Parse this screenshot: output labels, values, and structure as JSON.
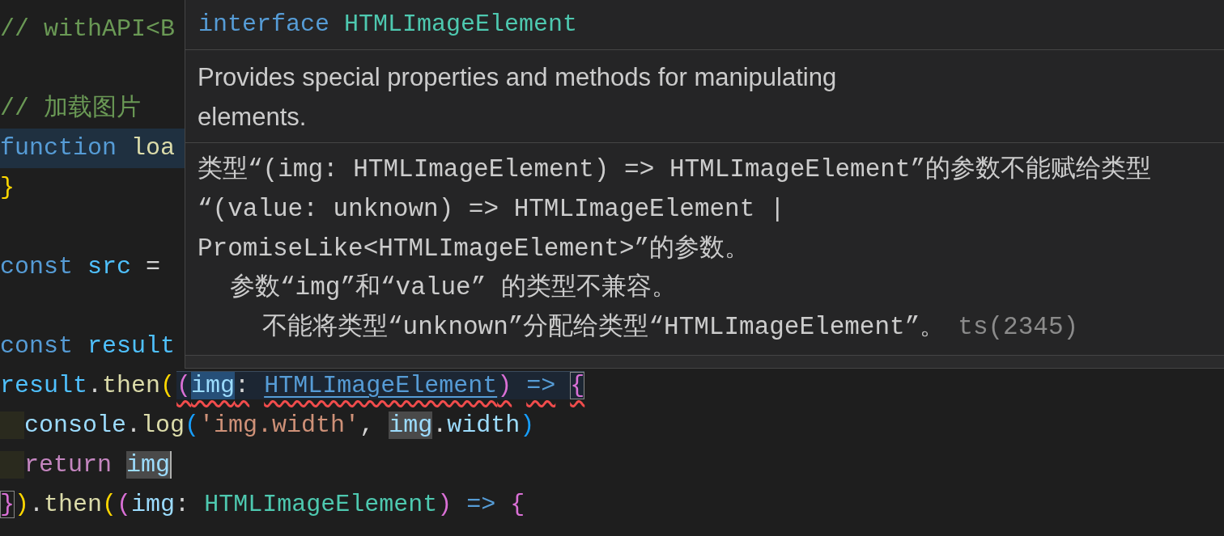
{
  "editor": {
    "lines": [
      {
        "tokens": [
          {
            "text": "// withAPI<B",
            "kind": "comment"
          }
        ]
      },
      {
        "blank_before": true,
        "tokens": [
          {
            "text": "// 加载图片",
            "kind": "comment"
          }
        ]
      },
      {
        "highlighted": true,
        "tokens": [
          {
            "text": "function",
            "kind": "keyword"
          },
          {
            "text": "loa",
            "kind": "function",
            "space": true
          }
        ]
      },
      {
        "tokens": [
          {
            "text": "}",
            "kind": "bracket_yellow"
          }
        ]
      },
      {
        "blank_before": true,
        "tokens": [
          {
            "text": "const",
            "kind": "keyword"
          },
          {
            "text": "src",
            "kind": "constant",
            "space": true
          },
          {
            "text": "=",
            "kind": "plain",
            "space": true
          }
        ]
      },
      {
        "blank_before": true,
        "tokens": [
          {
            "text": "const",
            "kind": "keyword"
          },
          {
            "text": "result",
            "kind": "constant",
            "space": true
          }
        ]
      },
      {
        "tokens": [
          {
            "text": "result",
            "kind": "constant"
          },
          {
            "text": ".",
            "kind": "plain"
          },
          {
            "text": "then",
            "kind": "function"
          },
          {
            "text": "(",
            "kind": "bracket_yellow"
          }
        ],
        "range": {
          "error": true,
          "tokens": [
            {
              "text": "(",
              "kind": "bracket_pink"
            },
            {
              "text": "img",
              "kind": "variable",
              "selected": true
            },
            {
              "text": ":",
              "kind": "plain"
            },
            {
              "text": "HTMLImageElement",
              "kind": "type_link",
              "space": true,
              "link": true
            },
            {
              "text": ")",
              "kind": "bracket_pink"
            },
            {
              "text": "=>",
              "kind": "keyword",
              "space": true
            },
            {
              "text": "{",
              "kind": "bracket_pink",
              "space": true,
              "bracket_match": true
            }
          ]
        }
      },
      {
        "indent": true,
        "tokens": [
          {
            "text": "console",
            "kind": "variable"
          },
          {
            "text": ".",
            "kind": "plain"
          },
          {
            "text": "log",
            "kind": "function"
          },
          {
            "text": "(",
            "kind": "bracket_blue"
          },
          {
            "text": "'img.width'",
            "kind": "string"
          },
          {
            "text": ",",
            "kind": "plain"
          },
          {
            "text": "img",
            "kind": "variable",
            "space": true,
            "reference": true
          },
          {
            "text": ".",
            "kind": "plain"
          },
          {
            "text": "width",
            "kind": "variable"
          },
          {
            "text": ")",
            "kind": "bracket_blue"
          }
        ]
      },
      {
        "indent": true,
        "cursor": true,
        "tokens": [
          {
            "text": "return",
            "kind": "control"
          },
          {
            "text": "img",
            "kind": "variable",
            "space": true,
            "reference": true
          }
        ]
      },
      {
        "tokens": [
          {
            "text": "}",
            "kind": "bracket_pink",
            "bracket_match": true
          },
          {
            "text": ")",
            "kind": "bracket_yellow"
          },
          {
            "text": ".",
            "kind": "plain"
          },
          {
            "text": "then",
            "kind": "function"
          },
          {
            "text": "(",
            "kind": "bracket_yellow"
          },
          {
            "text": "(",
            "kind": "bracket_pink"
          },
          {
            "text": "img",
            "kind": "variable"
          },
          {
            "text": ":",
            "kind": "plain"
          },
          {
            "text": "HTMLImageElement",
            "kind": "type",
            "space": true
          },
          {
            "text": ")",
            "kind": "bracket_pink"
          },
          {
            "text": "=>",
            "kind": "keyword",
            "space": true
          },
          {
            "text": "{",
            "kind": "bracket_pink",
            "space": true
          }
        ]
      }
    ]
  },
  "hover": {
    "signature": [
      {
        "text": "interface",
        "kind": "keyword"
      },
      {
        "text": "HTMLImageElement",
        "kind": "type",
        "space": true
      }
    ],
    "documentation": "Provides special properties and methods for manipulating elements.",
    "error": {
      "lines": [
        "类型“(img: HTMLImageElement) => HTMLImageElement”的参数不能赋给类型",
        "“(value: unknown) => HTMLImageElement |",
        "PromiseLike<HTMLImageElement>”的参数。"
      ],
      "children": [
        {
          "text": "参数“img”和“value” 的类型不兼容。",
          "children": [
            {
              "text": "不能将类型“unknown”分配给类型“HTMLImageElement”。",
              "code": "ts(2345)"
            }
          ]
        }
      ]
    }
  }
}
